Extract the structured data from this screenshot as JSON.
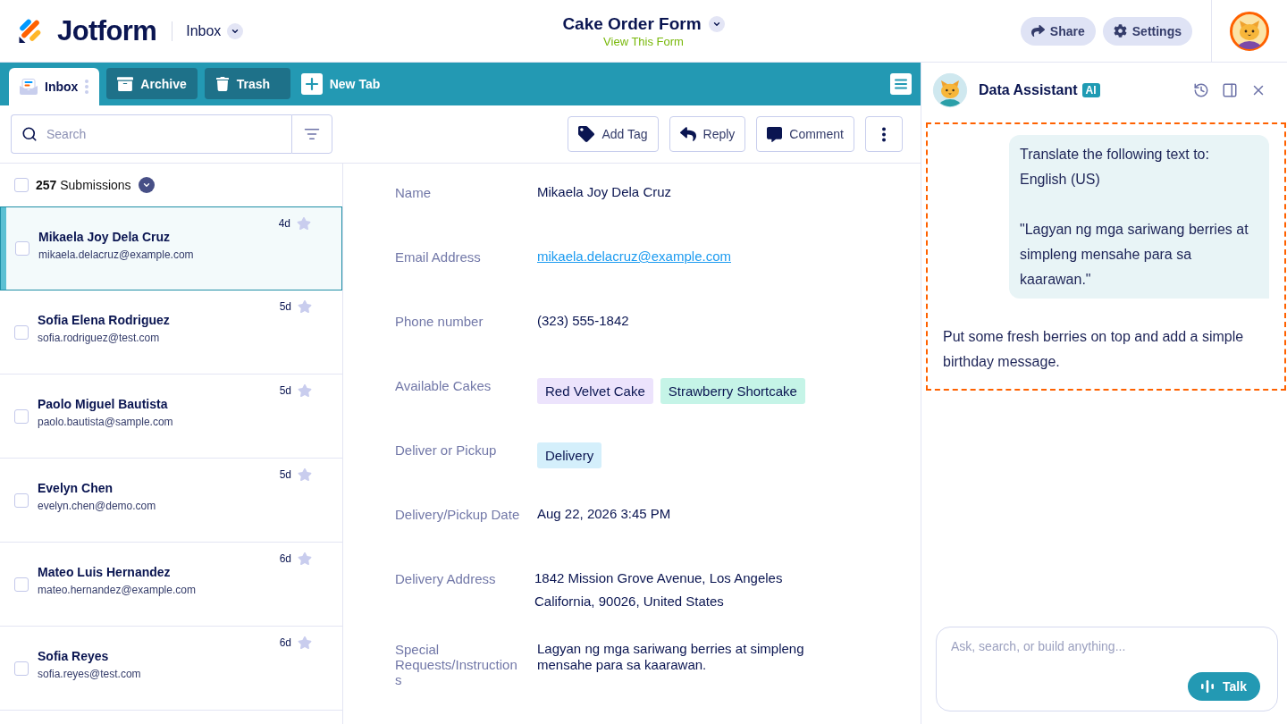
{
  "header": {
    "logo_text": "Jotform",
    "section": "Inbox",
    "form_title": "Cake Order Form",
    "form_link": "View This Form",
    "buttons": [
      {
        "label": "Share",
        "kind": "share"
      },
      {
        "label": "Settings",
        "kind": "settings"
      }
    ]
  },
  "tabs": [
    {
      "label": "Inbox",
      "kind": "inbox",
      "selected": true
    },
    {
      "label": "Archive",
      "kind": "archive",
      "selected": false
    },
    {
      "label": "Trash",
      "kind": "trash",
      "selected": false
    }
  ],
  "new_tab": {
    "label": "New Tab"
  },
  "search": {
    "placeholder": "Search"
  },
  "actions": [
    {
      "label": "Add Tag",
      "kind": "tag"
    },
    {
      "label": "Reply",
      "kind": "reply"
    },
    {
      "label": "Comment",
      "kind": "comment"
    }
  ],
  "submissions": {
    "all_checked": false,
    "count_label": "**257** Submissions",
    "items": [
      {
        "name": "Mikaela Joy Dela Cruz",
        "email": "mikaela.delacruz@example.com",
        "age": "4d",
        "selected": true,
        "checked": false,
        "starred": false
      },
      {
        "name": "Sofia Elena Rodriguez",
        "email": "sofia.rodriguez@test.com",
        "age": "5d",
        "selected": false,
        "checked": false,
        "starred": false
      },
      {
        "name": "Paolo Miguel Bautista",
        "email": "paolo.bautista@sample.com",
        "age": "5d",
        "selected": false,
        "checked": false,
        "starred": false
      },
      {
        "name": "Evelyn Chen",
        "email": "evelyn.chen@demo.com",
        "age": "5d",
        "selected": false,
        "checked": false,
        "starred": false
      },
      {
        "name": "Mateo Luis Hernandez",
        "email": "mateo.hernandez@example.com",
        "age": "6d",
        "selected": false,
        "checked": false,
        "starred": false
      },
      {
        "name": "Sofia Reyes",
        "email": "sofia.reyes@test.com",
        "age": "6d",
        "selected": false,
        "checked": false,
        "starred": false
      }
    ]
  },
  "detail": {
    "fields": [
      {
        "label": "Name",
        "kind": "text",
        "value": "Mikaela Joy Dela Cruz"
      },
      {
        "label": "Email Address",
        "kind": "link",
        "value": "mikaela.delacruz@example.com"
      },
      {
        "label": "Phone number",
        "kind": "text",
        "value": "(323) 555-1842"
      },
      {
        "label": "Available Cakes",
        "kind": "tags",
        "tags": [
          {
            "text": "Red Velvet Cake",
            "color": "#ece3fc"
          },
          {
            "text": "Strawberry Shortcake",
            "color": "#c5f4e7"
          }
        ]
      },
      {
        "label": "Deliver or Pickup",
        "kind": "tags",
        "tags": [
          {
            "text": "Delivery",
            "color": "#d4effb"
          }
        ]
      },
      {
        "label": "Delivery/Pickup Date",
        "kind": "text",
        "value": "Aug 22, 2026 3:45 PM"
      },
      {
        "label": "Delivery Address",
        "kind": "lines",
        "lines": [
          "1842 Mission Grove Avenue, Los Angeles",
          "California, 90026, United States"
        ]
      },
      {
        "label": "Special Requests/Instructions",
        "kind": "text",
        "value": "Lagyan ng mga sariwang berries at simpleng mensahe para sa kaarawan."
      }
    ]
  },
  "assistant": {
    "title": "Data Assistant",
    "badge": "AI",
    "highlighted": true,
    "messages": [
      {
        "kind": "user",
        "text": "Translate the following text to: English (US)\n\n\"Lagyan ng mga sariwang berries at simpleng mensahe para sa kaarawan.\""
      },
      {
        "kind": "reply",
        "text": "Put some fresh berries on top and add a simple birthday message."
      }
    ],
    "input": {
      "placeholder": "Ask, search, or build anything..."
    },
    "talk_button": "Talk"
  }
}
